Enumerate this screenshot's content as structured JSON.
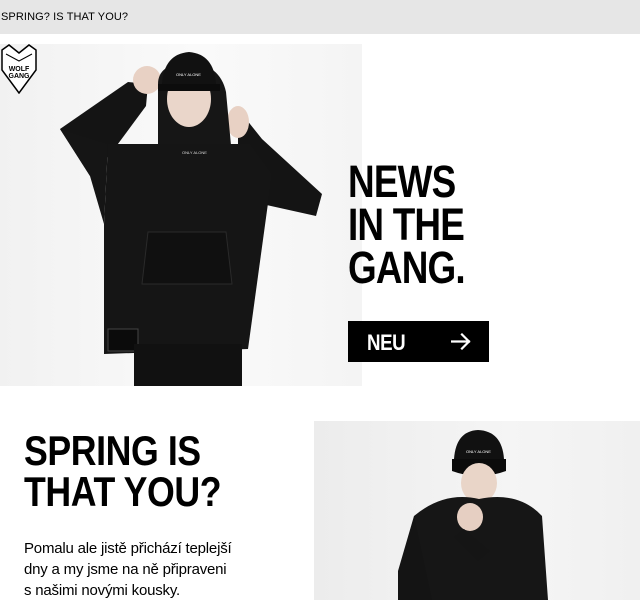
{
  "topbar": {
    "title": "SPRING? IS THAT YOU?"
  },
  "hero": {
    "logo_text_line1": "WOLF",
    "logo_text_line2": "GANG",
    "headline_line1": "NEWS",
    "headline_line2": "IN THE",
    "headline_line3": "GANG.",
    "cta_label": "NEU",
    "cta_icon": "arrow-right-icon",
    "cap_text": "ONLY ALONE",
    "hoodie_text": "ONLY ALONE"
  },
  "section2": {
    "headline_line1": "SPRING IS",
    "headline_line2": "THAT YOU?",
    "body_line1": "Pomalu ale jistě přichází teplejší",
    "body_line2": "dny a my jsme na ně připraveni",
    "body_line3": "s našimi novými kousky.",
    "cap_text": "ONLY ALONE"
  },
  "colors": {
    "topbar_bg": "#e6e6e6",
    "cta_bg": "#000000",
    "cta_text": "#ffffff"
  }
}
